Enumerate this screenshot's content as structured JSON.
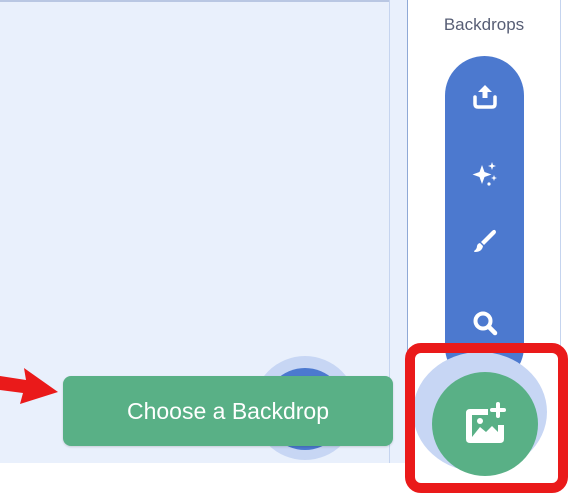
{
  "panel": {
    "title": "Backdrops"
  },
  "menu": {
    "items": [
      {
        "name": "upload",
        "icon": "upload-icon"
      },
      {
        "name": "surprise",
        "icon": "sparkles-icon"
      },
      {
        "name": "paint",
        "icon": "paintbrush-icon"
      },
      {
        "name": "search",
        "icon": "search-icon"
      }
    ]
  },
  "tooltip": {
    "label": "Choose a Backdrop"
  },
  "main_button": {
    "icon": "add-backdrop-icon"
  },
  "colors": {
    "menu_blue": "#4c79cf",
    "green": "#59b086",
    "highlight_red": "#ea1a1a",
    "stage_bg": "#e9f0fc"
  }
}
